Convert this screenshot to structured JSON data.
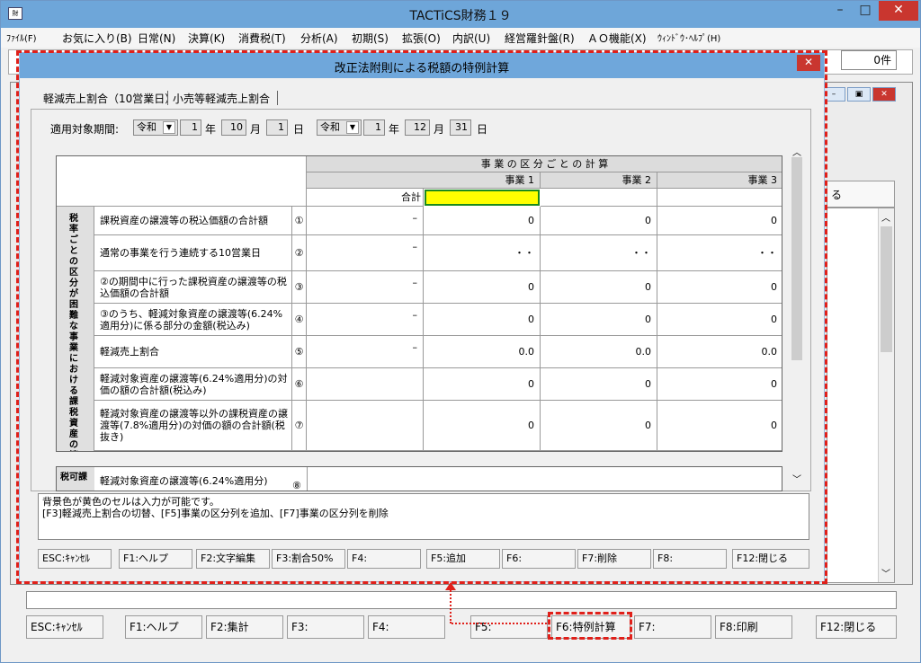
{
  "app": {
    "title": "TACTiCS財務１９",
    "count": "0件",
    "close_glyph": "✕",
    "minimize_glyph": "–",
    "maximize_glyph": "□"
  },
  "menu": [
    "ﾌｧｲﾙ(F)",
    "お気に入り(B)",
    "日常(N)",
    "決算(K)",
    "消費税(T)",
    "分析(A)",
    "初期(S)",
    "拡張(O)",
    "内訳(U)",
    "経営羅針盤(R)",
    "ＡＯ機能(X)",
    "ｳｨﾝﾄﾞｳ･ﾍﾙﾌﾟ(H)"
  ],
  "background": {
    "fragment": "る"
  },
  "dialog": {
    "title": "改正法附則による税額の特例計算",
    "tabs": [
      "軽減売上割合（10営業日）",
      "小売等軽減売上割合"
    ],
    "period_label": "適用対象期間:",
    "from": {
      "era": "令和",
      "year": "1",
      "month": "10",
      "day": "1"
    },
    "to": {
      "era": "令和",
      "year": "1",
      "month": "12",
      "day": "31"
    },
    "units": {
      "year": "年",
      "month": "月",
      "day": "日"
    },
    "grid": {
      "group_header": "事 業 の 区 分 ご と の 計 算",
      "columns": [
        "事業 1",
        "事業 2",
        "事業 3"
      ],
      "total_label": "合計",
      "side_label": "税率ごとの区分が困難な事業における課税資産の譲渡等",
      "rows": [
        {
          "label": "課税資産の譲渡等の税込価額の合計額",
          "no": "①",
          "total": "–",
          "values": [
            "0",
            "0",
            "0"
          ]
        },
        {
          "label": "通常の事業を行う連続する10営業日",
          "no": "②",
          "total": "–",
          "values": [
            "・・",
            "・・",
            "・・"
          ]
        },
        {
          "label": "②の期間中に行った課税資産の譲渡等の税込価額の合計額",
          "no": "③",
          "total": "–",
          "values": [
            "0",
            "0",
            "0"
          ]
        },
        {
          "label": "③のうち、軽減対象資産の譲渡等(6.24%適用分)に係る部分の金額(税込み)",
          "no": "④",
          "total": "–",
          "values": [
            "0",
            "0",
            "0"
          ]
        },
        {
          "label": "軽減売上割合",
          "no": "⑤",
          "total": "–",
          "values": [
            "0.0",
            "0.0",
            "0.0"
          ]
        },
        {
          "label": "軽減対象資産の譲渡等(6.24%適用分)の対価の額の合計額(税込み)",
          "no": "⑥",
          "total": "",
          "values": [
            "0",
            "0",
            "0"
          ]
        },
        {
          "label": "軽減対象資産の譲渡等以外の課税資産の譲渡等(7.8%適用分)の対価の額の合計額(税抜き)",
          "no": "⑦",
          "total": "",
          "values": [
            "0",
            "0",
            "0"
          ]
        }
      ],
      "next_side_label": "税可課",
      "next_row_label": "軽減対象資産の譲渡等(6.24%適用分)",
      "next_row_no": "⑧"
    },
    "message_line1": "背景色が黄色のセルは入力が可能です。",
    "message_line2": "[F3]軽減売上割合の切替、[F5]事業の区分列を追加、[F7]事業の区分列を削除",
    "fkeys": [
      "ESC:ｷｬﾝｾﾙ",
      "F1:ヘルプ",
      "F2:文字編集",
      "F3:割合50%",
      "F4:",
      "F5:追加",
      "F6:",
      "F7:削除",
      "F8:",
      "F12:閉じる"
    ]
  },
  "bottom_fkeys": [
    "ESC:ｷｬﾝｾﾙ",
    "F1:ヘルプ",
    "F2:集計",
    "F3:",
    "F4:",
    "F5:",
    "F6:特例計算",
    "F7:",
    "F8:印刷",
    "F12:閉じる"
  ],
  "colors": {
    "highlight": "#e0201a",
    "input_cell": "#ffff00"
  }
}
